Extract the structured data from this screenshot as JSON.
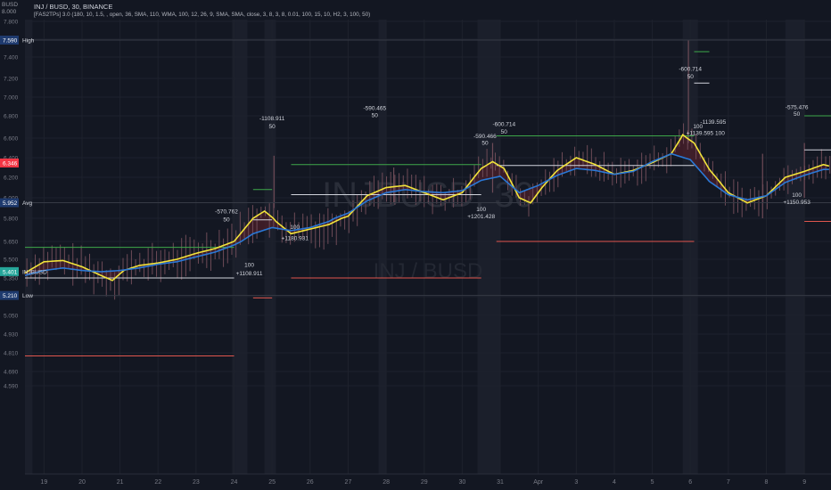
{
  "header": {
    "symbol_line": "INJ / BUSD, 30, BINANCE",
    "indicator_line": "[FAS2TPs] 3.0 (180, 10, 1.5, , open, 36, SMA, 110, WMA, 100, 12, 26, 9, SMA, SMA, close, 3, 8, 3, 8, 0.01, 100, 15, 10, H2, 3, 100, 50)"
  },
  "corner": {
    "line1": "BUSD",
    "line2": "8.000"
  },
  "watermark": {
    "big": "INJBUSD, 30",
    "small": "INJ / BUSD"
  },
  "colors": {
    "bg": "#131722",
    "grid": "#1e222d",
    "candle": "#6e4b57",
    "yellow": "#f2e33a",
    "blue": "#2a78d6",
    "fill": "#4b1f2a",
    "white": "#d1d4dc",
    "green": "#3ea84a",
    "red": "#e0564e",
    "magenta": "#e040fb",
    "label_dark": "#1e3a6e",
    "price_red": "#f23645",
    "price_teal": "#26a69a"
  },
  "chart_data": {
    "type": "line",
    "title": "INJ / BUSD, 30, BINANCE",
    "ylim": [
      4.5,
      8.0
    ],
    "y_ticks": [
      "7.800",
      "7.600",
      "7.400",
      "7.200",
      "7.000",
      "6.800",
      "6.600",
      "6.400",
      "6.200",
      "6.000",
      "5.800",
      "5.650",
      "5.500",
      "5.350",
      "5.200",
      "5.050",
      "4.930",
      "4.810",
      "4.690",
      "4.590"
    ],
    "y_tick_values": [
      7.8,
      7.6,
      7.4,
      7.2,
      7.0,
      6.8,
      6.6,
      6.4,
      6.2,
      6.0,
      5.8,
      5.65,
      5.5,
      5.35,
      5.2,
      5.05,
      4.93,
      4.81,
      4.69,
      4.59
    ],
    "x_ticks": [
      "19",
      "20",
      "21",
      "22",
      "23",
      "24",
      "25",
      "26",
      "27",
      "28",
      "29",
      "30",
      "31",
      "Apr",
      "3",
      "4",
      "5",
      "6",
      "7",
      "8",
      "9"
    ],
    "x_tick_values": [
      0.5,
      1.5,
      2.5,
      3.5,
      4.5,
      5.5,
      6.5,
      7.5,
      8.5,
      9.5,
      10.5,
      11.5,
      12.5,
      13.5,
      14.5,
      15.5,
      16.5,
      17.5,
      18.5,
      19.5,
      20.5
    ],
    "xlim": [
      0,
      21.2
    ],
    "series": [
      {
        "name": "",
        "color": "#f2e33a",
        "x": [
          0,
          0.5,
          1,
          1.5,
          2,
          2.3,
          2.6,
          3,
          3.5,
          4,
          4.5,
          5,
          5.5,
          6,
          6.3,
          6.6,
          7,
          7.5,
          8,
          8.5,
          9,
          9.5,
          10,
          10.5,
          11,
          11.5,
          12,
          12.3,
          12.6,
          13,
          13.3,
          13.6,
          14,
          14.5,
          15,
          15.5,
          16,
          16.5,
          17,
          17.3,
          17.6,
          18,
          18.5,
          19,
          19.5,
          20,
          20.5,
          21,
          21.2
        ],
        "values": [
          5.39,
          5.48,
          5.49,
          5.44,
          5.37,
          5.33,
          5.41,
          5.45,
          5.47,
          5.5,
          5.55,
          5.59,
          5.65,
          5.8,
          5.87,
          5.78,
          5.7,
          5.73,
          5.76,
          5.82,
          6.02,
          6.1,
          6.12,
          6.05,
          5.98,
          6.05,
          6.29,
          6.36,
          6.29,
          6.0,
          5.95,
          6.1,
          6.27,
          6.4,
          6.33,
          6.23,
          6.27,
          6.35,
          6.44,
          6.63,
          6.55,
          6.28,
          6.05,
          5.95,
          6.02,
          6.2,
          6.26,
          6.33,
          6.31
        ]
      },
      {
        "name": "",
        "color": "#2a78d6",
        "x": [
          0,
          0.5,
          1,
          1.5,
          2,
          2.5,
          3,
          3.5,
          4,
          4.5,
          5,
          5.5,
          6,
          6.5,
          7,
          7.5,
          8,
          8.5,
          9,
          9.5,
          10,
          10.5,
          11,
          11.5,
          12,
          12.5,
          13,
          13.5,
          14,
          14.5,
          15,
          15.5,
          16,
          16.5,
          17,
          17.5,
          18,
          18.5,
          19,
          19.5,
          20,
          20.5,
          21,
          21.2
        ],
        "values": [
          5.37,
          5.41,
          5.43,
          5.41,
          5.4,
          5.41,
          5.43,
          5.46,
          5.48,
          5.52,
          5.56,
          5.62,
          5.7,
          5.74,
          5.72,
          5.74,
          5.78,
          5.85,
          5.97,
          6.05,
          6.08,
          6.06,
          6.05,
          6.07,
          6.17,
          6.21,
          6.05,
          6.12,
          6.22,
          6.29,
          6.27,
          6.23,
          6.26,
          6.36,
          6.44,
          6.38,
          6.16,
          6.03,
          5.98,
          6.02,
          6.15,
          6.22,
          6.28,
          6.28
        ]
      }
    ],
    "horizontal_levels": [
      {
        "color": "#3ea84a",
        "y": 5.6,
        "x0": 0,
        "x1": 5.5
      },
      {
        "color": "#d1d4dc",
        "y": 5.35,
        "x0": 0,
        "x1": 5.5
      },
      {
        "color": "#e0564e",
        "y": 4.79,
        "x0": 0,
        "x1": 5.5
      },
      {
        "color": "#3ea84a",
        "y": 6.08,
        "x0": 6.0,
        "x1": 6.5
      },
      {
        "color": "#d1d4dc",
        "y": 5.79,
        "x0": 6.0,
        "x1": 6.5
      },
      {
        "color": "#e0564e",
        "y": 5.19,
        "x0": 6.0,
        "x1": 6.5
      },
      {
        "color": "#3ea84a",
        "y": 6.33,
        "x0": 7.0,
        "x1": 12.0
      },
      {
        "color": "#d1d4dc",
        "y": 6.03,
        "x0": 7.0,
        "x1": 12.0
      },
      {
        "color": "#e0564e",
        "y": 5.35,
        "x0": 7.0,
        "x1": 12.0
      },
      {
        "color": "#3ea84a",
        "y": 6.62,
        "x0": 12.4,
        "x1": 17.6
      },
      {
        "color": "#d1d4dc",
        "y": 6.32,
        "x0": 12.4,
        "x1": 17.6
      },
      {
        "color": "#e0564e",
        "y": 5.65,
        "x0": 12.4,
        "x1": 17.6
      },
      {
        "color": "#3ea84a",
        "y": 7.46,
        "x0": 17.6,
        "x1": 18.0
      },
      {
        "color": "#d1d4dc",
        "y": 7.15,
        "x0": 17.6,
        "x1": 18.0
      },
      {
        "color": "#3ea84a",
        "y": 6.8,
        "x0": 20.5,
        "x1": 21.2
      },
      {
        "color": "#d1d4dc",
        "y": 6.48,
        "x0": 20.5,
        "x1": 21.2
      },
      {
        "color": "#e0564e",
        "y": 5.78,
        "x0": 20.5,
        "x1": 21.2
      }
    ],
    "annotations": [
      {
        "text": "-1108.911",
        "x": 6.5,
        "y": 6.76,
        "color": "#d1d4dc"
      },
      {
        "text": "50",
        "x": 6.5,
        "y": 6.69,
        "color": "#d1d4dc"
      },
      {
        "text": "-570.762",
        "x": 5.3,
        "y": 5.85,
        "color": "#d1d4dc"
      },
      {
        "text": "50",
        "x": 5.3,
        "y": 5.78,
        "color": "#d1d4dc"
      },
      {
        "text": "100",
        "x": 7.1,
        "y": 5.73,
        "color": "#d1d4dc"
      },
      {
        "text": "+1180.931",
        "x": 7.1,
        "y": 5.66,
        "color": "#d1d4dc"
      },
      {
        "text": "100",
        "x": 5.9,
        "y": 5.44,
        "color": "#d1d4dc"
      },
      {
        "text": "+1108.911",
        "x": 5.9,
        "y": 5.37,
        "color": "#d1d4dc"
      },
      {
        "text": "-590.465",
        "x": 9.2,
        "y": 6.86,
        "color": "#d1d4dc"
      },
      {
        "text": "50",
        "x": 9.2,
        "y": 6.79,
        "color": "#d1d4dc"
      },
      {
        "text": "-600.714",
        "x": 12.6,
        "y": 6.71,
        "color": "#d1d4dc"
      },
      {
        "text": "-590.466",
        "x": 12.1,
        "y": 6.6,
        "color": "#d1d4dc"
      },
      {
        "text": "50",
        "x": 12.1,
        "y": 6.53,
        "color": "#d1d4dc"
      },
      {
        "text": "50",
        "x": 12.6,
        "y": 6.64,
        "color": "#d1d4dc"
      },
      {
        "text": "100",
        "x": 12.0,
        "y": 5.87,
        "color": "#d1d4dc"
      },
      {
        "text": "+1201.428",
        "x": 12.0,
        "y": 5.8,
        "color": "#d1d4dc"
      },
      {
        "text": "-600.714",
        "x": 17.5,
        "y": 7.27,
        "color": "#d1d4dc"
      },
      {
        "text": "50",
        "x": 17.5,
        "y": 7.2,
        "color": "#d1d4dc"
      },
      {
        "text": "-1139.595",
        "x": 18.1,
        "y": 6.73,
        "color": "#d1d4dc"
      },
      {
        "text": "100",
        "x": 17.7,
        "y": 6.69,
        "color": "#d1d4dc"
      },
      {
        "text": "+1139.595 100",
        "x": 17.9,
        "y": 6.63,
        "color": "#d1d4dc"
      },
      {
        "text": "-575.476",
        "x": 20.3,
        "y": 6.87,
        "color": "#d1d4dc"
      },
      {
        "text": "50",
        "x": 20.3,
        "y": 6.8,
        "color": "#d1d4dc"
      },
      {
        "text": "100",
        "x": 20.3,
        "y": 6.01,
        "color": "#d1d4dc"
      },
      {
        "text": "+1150.953",
        "x": 20.3,
        "y": 5.94,
        "color": "#d1d4dc"
      }
    ],
    "price_labels": [
      {
        "text": "7.590",
        "tag": "High",
        "y": 7.59,
        "style": "dark"
      },
      {
        "text": "6.346",
        "tag": "",
        "y": 6.346,
        "style": "red"
      },
      {
        "text": "5.952",
        "tag": "Avg",
        "y": 5.952,
        "style": "dark"
      },
      {
        "text": "5.401",
        "tag": "INJBUSD",
        "y": 5.401,
        "style": "teal"
      },
      {
        "text": "5.210",
        "tag": "Low",
        "y": 5.21,
        "style": "dark"
      }
    ],
    "shaded_sessions": [
      [
        0,
        0.2
      ],
      [
        5.45,
        5.85
      ],
      [
        6.3,
        6.6
      ],
      [
        9.3,
        9.5
      ],
      [
        11.9,
        12.5
      ],
      [
        17.3,
        17.7
      ],
      [
        20.0,
        20.5
      ]
    ]
  }
}
